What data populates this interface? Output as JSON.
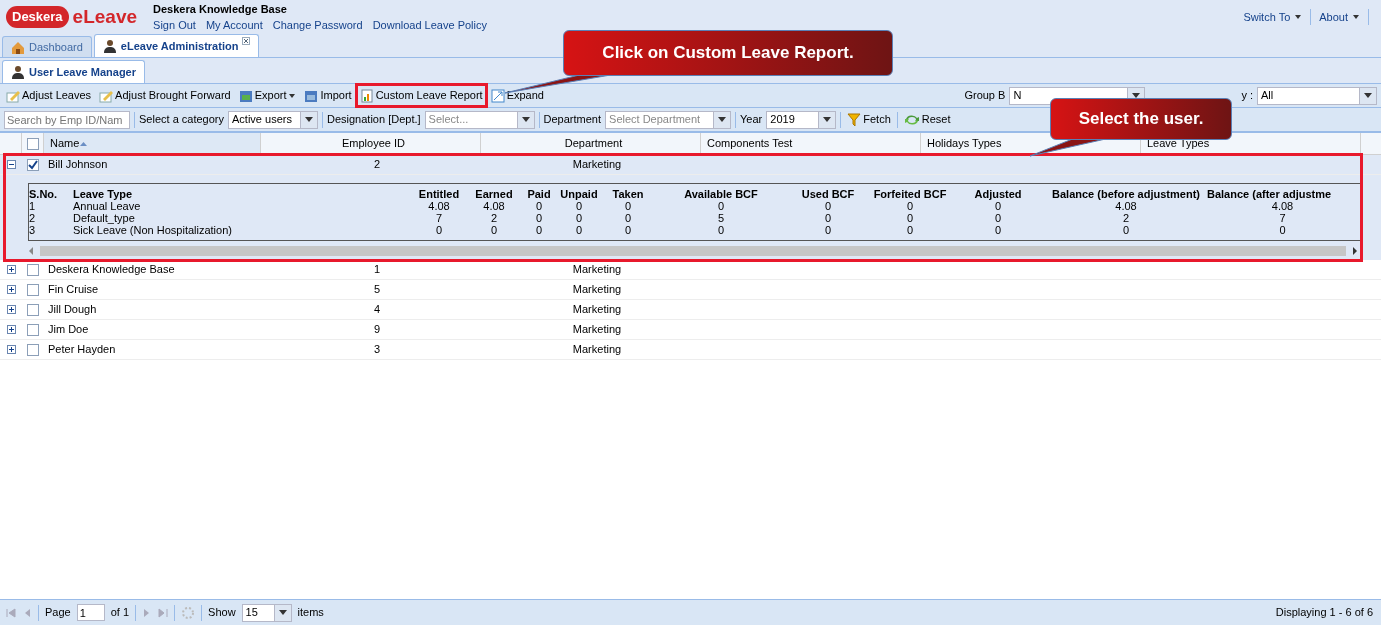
{
  "header": {
    "brand": "Deskera",
    "app_name": "eLeave",
    "company": "Deskera Knowledge Base",
    "links": [
      "Sign Out",
      "My Account",
      "Change Password",
      "Download Leave Policy"
    ],
    "right_menu": [
      "Switch To",
      "About"
    ]
  },
  "tabs": [
    {
      "label": "Dashboard",
      "selected": false,
      "closable": false
    },
    {
      "label": "eLeave Administration",
      "selected": true,
      "closable": true
    }
  ],
  "subtabs": [
    {
      "label": "User Leave Manager",
      "selected": true
    }
  ],
  "toolbar": [
    {
      "label": "Adjust Leaves",
      "kind": "button",
      "highlighted": false
    },
    {
      "label": "Adjust Brought Forward",
      "kind": "button",
      "highlighted": false
    },
    {
      "label": "Export",
      "kind": "menu",
      "highlighted": false
    },
    {
      "label": "Import",
      "kind": "button",
      "highlighted": false
    },
    {
      "label": "Custom Leave Report",
      "kind": "button",
      "highlighted": true
    },
    {
      "label": "Expand",
      "kind": "button",
      "highlighted": false
    }
  ],
  "group_by": {
    "label": "Group B",
    "value": "N"
  },
  "filter_by": {
    "label": "y :",
    "value": "All"
  },
  "filters": {
    "search": {
      "placeholder": "Search by Emp ID/Nam"
    },
    "category": {
      "label": "Select a category",
      "value": "Active users"
    },
    "designation": {
      "label": "Designation [Dept.]",
      "placeholder": "Select..."
    },
    "department": {
      "label": "Department",
      "placeholder": "Select Department"
    },
    "year": {
      "label": "Year",
      "value": "2019"
    },
    "fetch": "Fetch",
    "reset": "Reset"
  },
  "table": {
    "header_checked": false,
    "columns": [
      {
        "label": "Name",
        "sorted": true
      },
      {
        "label": "Employee ID",
        "sorted": false
      },
      {
        "label": "Department",
        "sorted": false
      },
      {
        "label": "Components Test",
        "sorted": false
      },
      {
        "label": "Holidays Types",
        "sorted": false
      },
      {
        "label": "Leave Types",
        "sorted": false
      }
    ],
    "rows": [
      {
        "name": "Bill Johnson",
        "employee_id": "2",
        "department": "Marketing",
        "checked": true,
        "expanded": true,
        "highlighted": true
      },
      {
        "name": "Deskera Knowledge Base",
        "employee_id": "1",
        "department": "Marketing",
        "checked": false,
        "expanded": false,
        "highlighted": false
      },
      {
        "name": "Fin Cruise",
        "employee_id": "5",
        "department": "Marketing",
        "checked": false,
        "expanded": false,
        "highlighted": false
      },
      {
        "name": "Jill Dough",
        "employee_id": "4",
        "department": "Marketing",
        "checked": false,
        "expanded": false,
        "highlighted": false
      },
      {
        "name": "Jim Doe",
        "employee_id": "9",
        "department": "Marketing",
        "checked": false,
        "expanded": false,
        "highlighted": false
      },
      {
        "name": "Peter Hayden",
        "employee_id": "3",
        "department": "Marketing",
        "checked": false,
        "expanded": false,
        "highlighted": false
      }
    ],
    "detail": {
      "columns": [
        "S.No.",
        "Leave Type",
        "Entitled",
        "Earned",
        "Paid",
        "Unpaid",
        "Taken",
        "Available BCF",
        "Used BCF",
        "Forfeited BCF",
        "Adjusted",
        "Balance (before adjustment)",
        "Balance (after adjustme"
      ],
      "rows": [
        [
          "1",
          "Annual Leave",
          "4.08",
          "4.08",
          "0",
          "0",
          "0",
          "0",
          "0",
          "0",
          "0",
          "4.08",
          "4.08"
        ],
        [
          "2",
          "Default_type",
          "7",
          "2",
          "0",
          "0",
          "0",
          "5",
          "0",
          "0",
          "0",
          "2",
          "7"
        ],
        [
          "3",
          "Sick Leave (Non Hospitalization)",
          "0",
          "0",
          "0",
          "0",
          "0",
          "0",
          "0",
          "0",
          "0",
          "0",
          "0"
        ]
      ]
    }
  },
  "pager": {
    "page_label": "Page",
    "page": "1",
    "of": "of 1",
    "show": "Show",
    "page_size": "15",
    "items": "items",
    "displaying": "Displaying 1 - 6 of 6"
  },
  "callouts": [
    "Click on Custom Leave Report.",
    "Select the user."
  ]
}
